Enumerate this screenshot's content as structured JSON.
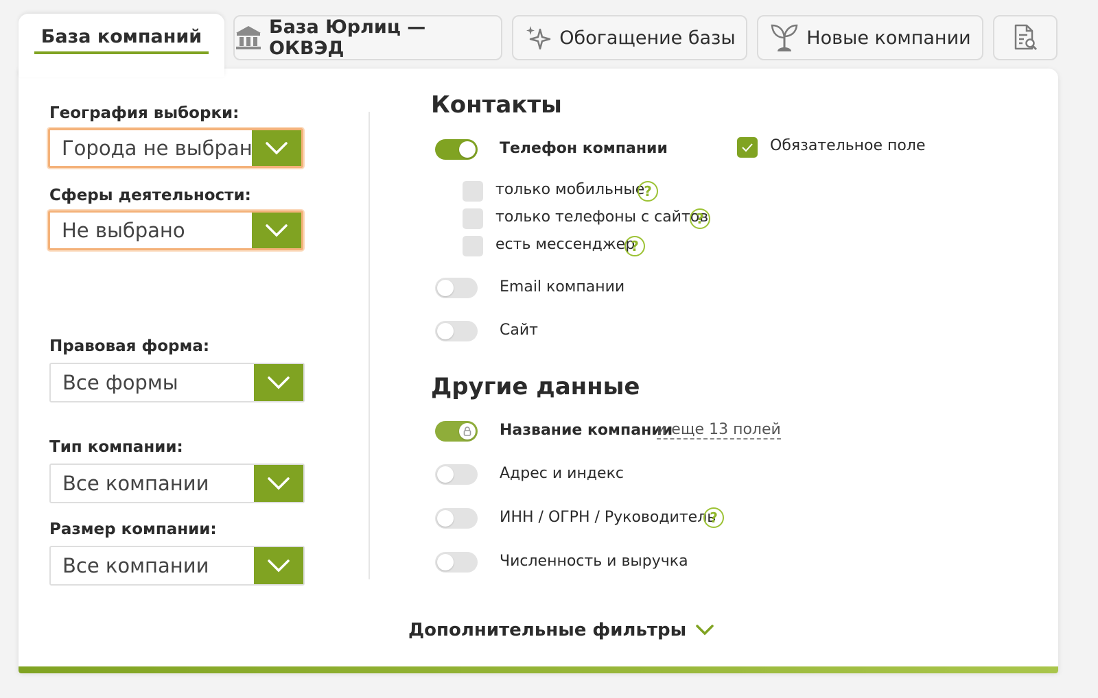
{
  "tabs": [
    {
      "label": "База компаний",
      "icon": "none",
      "active": true
    },
    {
      "label": "База Юрлиц — ОКВЭД",
      "icon": "bank-icon"
    },
    {
      "label": "Обогащение базы",
      "icon": "sparkles-icon"
    },
    {
      "label": "Новые компании",
      "icon": "sprout-icon"
    },
    {
      "label": "",
      "icon": "document-search-icon"
    }
  ],
  "filters": {
    "geography": {
      "label": "География выборки:",
      "value": "Города не выбраны"
    },
    "activity": {
      "label": "Сферы деятельности:",
      "value": "Не выбрано"
    },
    "legal_form": {
      "label": "Правовая форма:",
      "value": "Все формы"
    },
    "company_type": {
      "label": "Тип компании:",
      "value": "Все компании"
    },
    "company_size": {
      "label": "Размер компании:",
      "value": "Все компании"
    }
  },
  "contacts": {
    "title": "Контакты",
    "phone": {
      "label": "Телефон компании",
      "enabled": true
    },
    "required": {
      "label": "Обязательное поле",
      "checked": true
    },
    "phone_options": [
      {
        "label": "только мобильные",
        "checked": false
      },
      {
        "label": "только телефоны с сайтов",
        "checked": false
      },
      {
        "label": "есть мессенджер",
        "checked": false
      }
    ],
    "email": {
      "label": "Email компании",
      "enabled": false
    },
    "site": {
      "label": "Сайт",
      "enabled": false
    }
  },
  "other": {
    "title": "Другие данные",
    "name": {
      "label": "Название компании",
      "more": "и еще 13 полей",
      "enabled": true,
      "locked": true
    },
    "address": {
      "label": "Адрес и индекс",
      "enabled": false
    },
    "inn": {
      "label": "ИНН / ОГРН / Руководитель",
      "enabled": false
    },
    "staff": {
      "label": "Численность и выручка",
      "enabled": false
    }
  },
  "extra_filters": "Дополнительные фильтры",
  "help_symbol": "?",
  "colors": {
    "accent": "#80a322",
    "focus": "#f4b27a"
  }
}
